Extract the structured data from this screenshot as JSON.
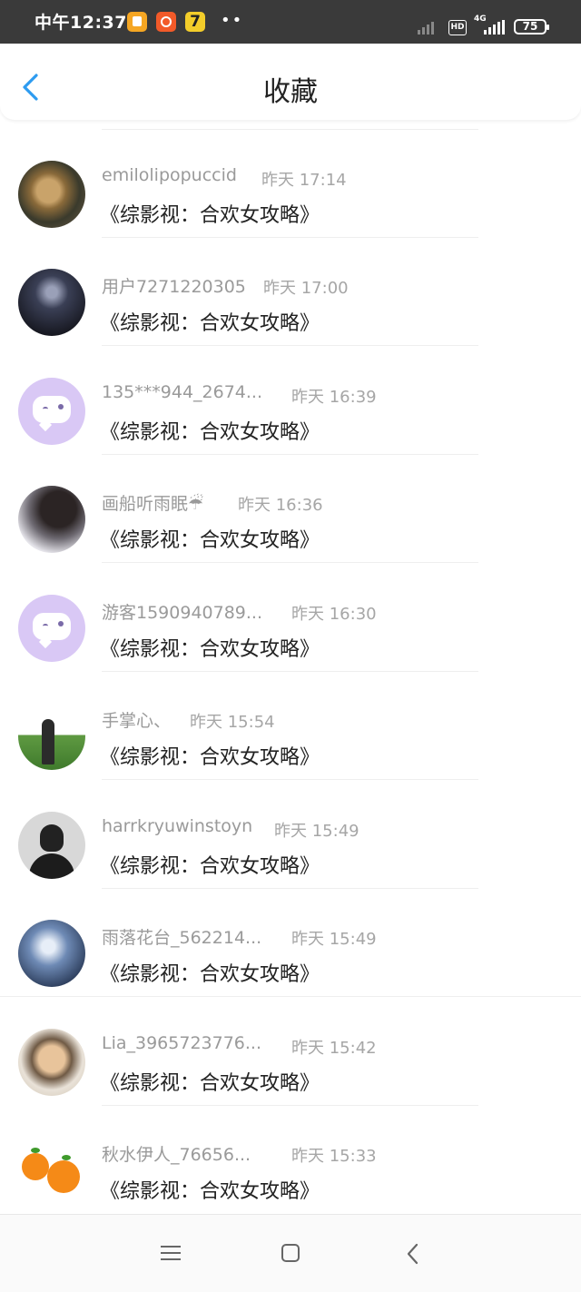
{
  "status_bar": {
    "time": "中午12:37",
    "app3_glyph": "7",
    "dots": "••",
    "hd": "HD",
    "network": "4G",
    "battery": "75"
  },
  "header": {
    "title": "收藏",
    "back_icon": "chevron-left-icon"
  },
  "items": [
    {
      "user": "emilolipopuccid",
      "time": "昨天 17:14",
      "title": "《综影视：合欢女攻略》"
    },
    {
      "user": "用户7271220305",
      "time": "昨天 17:00",
      "title": "《综影视：合欢女攻略》"
    },
    {
      "user": "135***944_2674...",
      "time": "昨天 16:39",
      "title": "《综影视：合欢女攻略》"
    },
    {
      "user": "画船听雨眠☔",
      "time": "昨天 16:36",
      "title": "《综影视：合欢女攻略》"
    },
    {
      "user": "游客1590940789...",
      "time": "昨天 16:30",
      "title": "《综影视：合欢女攻略》"
    },
    {
      "user": "手掌心、",
      "time": "昨天 15:54",
      "title": "《综影视：合欢女攻略》"
    },
    {
      "user": "harrkryuwinstoyn",
      "time": "昨天 15:49",
      "title": "《综影视：合欢女攻略》"
    },
    {
      "user": "雨落花台_562214...",
      "time": "昨天 15:49",
      "title": "《综影视：合欢女攻略》"
    },
    {
      "user": "Lia_3965723776...",
      "time": "昨天 15:42",
      "title": "《综影视：合欢女攻略》"
    },
    {
      "user": "秋水伊人_76656...",
      "time": "昨天 15:33",
      "title": "《综影视：合欢女攻略》"
    }
  ],
  "nav": {
    "menu_icon": "menu-icon",
    "home_icon": "home-square-icon",
    "back_icon": "back-triangle-icon"
  },
  "colors": {
    "accent": "#2d9bf0",
    "status_bar_bg": "#3a3a3a",
    "meta_text": "#9a9a9a"
  }
}
